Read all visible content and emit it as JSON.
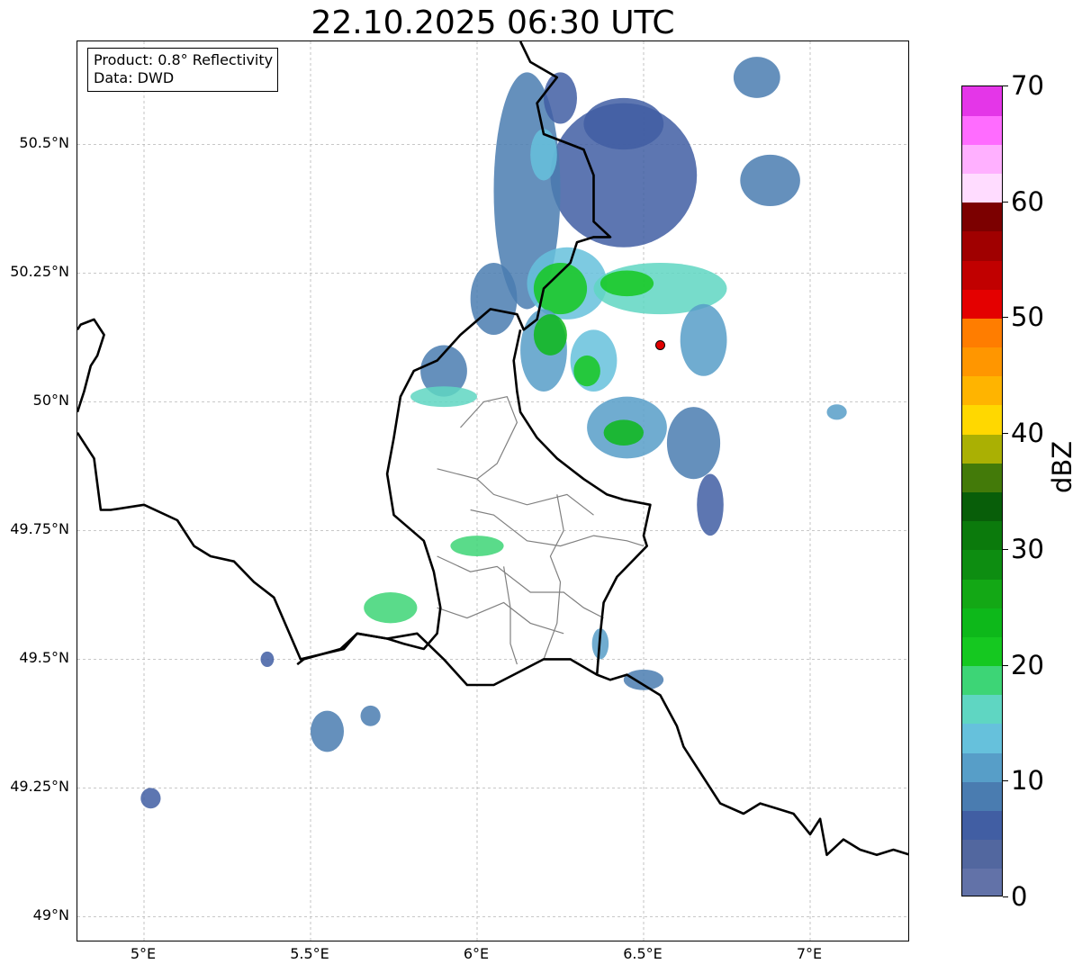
{
  "title": "22.10.2025 06:30 UTC",
  "info": {
    "product": "Product: 0.8° Reflectivity",
    "source": "Data: DWD"
  },
  "map": {
    "lon_range": [
      4.8,
      7.3
    ],
    "lat_range": [
      48.95,
      50.7
    ],
    "gridlines": true,
    "lat_ticks": [
      {
        "value": 50.5,
        "label": "50.5°N"
      },
      {
        "value": 50.25,
        "label": "50.25°N"
      },
      {
        "value": 50.0,
        "label": "50°N"
      },
      {
        "value": 49.75,
        "label": "49.75°N"
      },
      {
        "value": 49.5,
        "label": "49.5°N"
      },
      {
        "value": 49.25,
        "label": "49.25°N"
      },
      {
        "value": 49.0,
        "label": "49°N"
      }
    ],
    "lon_ticks": [
      {
        "value": 5.0,
        "label": "5°E"
      },
      {
        "value": 5.5,
        "label": "5.5°E"
      },
      {
        "value": 6.0,
        "label": "6°E"
      },
      {
        "value": 6.5,
        "label": "6.5°E"
      },
      {
        "value": 7.0,
        "label": "7°E"
      }
    ],
    "radar_site": {
      "lon": 6.55,
      "lat": 50.11,
      "color": "#e00000"
    },
    "borders": {
      "north": [
        [
          6.13,
          50.7
        ],
        [
          6.16,
          50.66
        ],
        [
          6.24,
          50.63
        ],
        [
          6.18,
          50.58
        ],
        [
          6.2,
          50.52
        ],
        [
          6.32,
          50.49
        ],
        [
          6.35,
          50.44
        ],
        [
          6.35,
          50.35
        ],
        [
          6.4,
          50.32
        ],
        [
          6.35,
          50.32
        ],
        [
          6.3,
          50.31
        ],
        [
          6.28,
          50.27
        ],
        [
          6.2,
          50.22
        ],
        [
          6.18,
          50.16
        ],
        [
          6.14,
          50.14
        ],
        [
          6.12,
          50.17
        ],
        [
          6.04,
          50.18
        ],
        [
          5.95,
          50.13
        ],
        [
          5.88,
          50.08
        ],
        [
          5.81,
          50.06
        ],
        [
          5.77,
          50.01
        ],
        [
          5.75,
          49.93
        ],
        [
          5.73,
          49.86
        ],
        [
          5.75,
          49.78
        ],
        [
          5.84,
          49.73
        ],
        [
          5.87,
          49.67
        ],
        [
          5.89,
          49.6
        ],
        [
          5.88,
          49.55
        ],
        [
          5.84,
          49.52
        ],
        [
          5.78,
          49.53
        ],
        [
          5.73,
          49.54
        ],
        [
          5.64,
          49.55
        ],
        [
          5.59,
          49.52
        ],
        [
          5.48,
          49.5
        ],
        [
          5.46,
          49.49
        ]
      ],
      "east": [
        [
          6.13,
          50.14
        ],
        [
          6.11,
          50.08
        ],
        [
          6.12,
          50.02
        ],
        [
          6.13,
          49.98
        ],
        [
          6.18,
          49.93
        ],
        [
          6.24,
          49.89
        ],
        [
          6.32,
          49.85
        ],
        [
          6.39,
          49.82
        ],
        [
          6.44,
          49.81
        ],
        [
          6.52,
          49.8
        ],
        [
          6.5,
          49.74
        ],
        [
          6.51,
          49.72
        ],
        [
          6.42,
          49.66
        ],
        [
          6.38,
          49.61
        ],
        [
          6.37,
          49.55
        ],
        [
          6.36,
          49.47
        ],
        [
          6.4,
          49.46
        ],
        [
          6.45,
          49.47
        ],
        [
          6.55,
          49.43
        ],
        [
          6.6,
          49.37
        ],
        [
          6.62,
          49.33
        ],
        [
          6.67,
          49.28
        ],
        [
          6.73,
          49.22
        ],
        [
          6.8,
          49.2
        ],
        [
          6.85,
          49.22
        ],
        [
          6.9,
          49.21
        ],
        [
          6.95,
          49.2
        ],
        [
          7.0,
          49.16
        ],
        [
          7.03,
          49.19
        ],
        [
          7.05,
          49.12
        ],
        [
          7.1,
          49.15
        ],
        [
          7.15,
          49.13
        ],
        [
          7.2,
          49.12
        ],
        [
          7.25,
          49.13
        ],
        [
          7.3,
          49.12
        ]
      ],
      "south": [
        [
          6.36,
          49.47
        ],
        [
          6.28,
          49.5
        ],
        [
          6.2,
          49.5
        ],
        [
          6.11,
          49.47
        ],
        [
          6.05,
          49.45
        ],
        [
          5.97,
          49.45
        ],
        [
          5.9,
          49.5
        ],
        [
          5.82,
          49.55
        ],
        [
          5.73,
          49.54
        ],
        [
          5.64,
          49.55
        ],
        [
          5.6,
          49.52
        ],
        [
          5.47,
          49.5
        ],
        [
          5.39,
          49.62
        ],
        [
          5.33,
          49.65
        ],
        [
          5.27,
          49.69
        ],
        [
          5.2,
          49.7
        ],
        [
          5.15,
          49.72
        ],
        [
          5.1,
          49.77
        ],
        [
          5.0,
          49.8
        ],
        [
          4.9,
          49.79
        ],
        [
          4.87,
          49.79
        ],
        [
          4.86,
          49.84
        ],
        [
          4.85,
          49.89
        ],
        [
          4.82,
          49.92
        ],
        [
          4.8,
          49.94
        ]
      ],
      "west": [
        [
          4.8,
          49.98
        ],
        [
          4.82,
          50.02
        ],
        [
          4.84,
          50.07
        ],
        [
          4.86,
          50.09
        ],
        [
          4.88,
          50.13
        ],
        [
          4.85,
          50.16
        ],
        [
          4.81,
          50.15
        ],
        [
          4.8,
          50.14
        ]
      ]
    },
    "cantons": [
      [
        [
          5.95,
          49.95
        ],
        [
          6.02,
          50.0
        ],
        [
          6.09,
          50.01
        ],
        [
          6.12,
          49.96
        ],
        [
          6.06,
          49.88
        ],
        [
          6.0,
          49.85
        ]
      ],
      [
        [
          5.88,
          49.87
        ],
        [
          6.0,
          49.85
        ],
        [
          6.05,
          49.82
        ],
        [
          6.15,
          49.8
        ],
        [
          6.27,
          49.82
        ],
        [
          6.35,
          49.78
        ]
      ],
      [
        [
          5.98,
          49.79
        ],
        [
          6.05,
          49.78
        ],
        [
          6.15,
          49.73
        ],
        [
          6.25,
          49.72
        ],
        [
          6.35,
          49.74
        ],
        [
          6.45,
          49.73
        ],
        [
          6.5,
          49.72
        ]
      ],
      [
        [
          5.88,
          49.7
        ],
        [
          5.98,
          49.67
        ],
        [
          6.06,
          49.68
        ],
        [
          6.16,
          49.63
        ],
        [
          6.26,
          49.63
        ],
        [
          6.32,
          49.6
        ],
        [
          6.38,
          49.58
        ]
      ],
      [
        [
          5.88,
          49.6
        ],
        [
          5.97,
          49.58
        ],
        [
          6.08,
          49.61
        ],
        [
          6.16,
          49.57
        ],
        [
          6.26,
          49.55
        ]
      ],
      [
        [
          6.08,
          49.68
        ],
        [
          6.1,
          49.6
        ],
        [
          6.1,
          49.53
        ],
        [
          6.12,
          49.49
        ]
      ],
      [
        [
          6.24,
          49.82
        ],
        [
          6.26,
          49.75
        ],
        [
          6.22,
          49.7
        ],
        [
          6.25,
          49.65
        ],
        [
          6.24,
          49.57
        ],
        [
          6.2,
          49.5
        ]
      ]
    ]
  },
  "reflectivity": {
    "cells": [
      {
        "lon": 6.44,
        "lat": 50.44,
        "rx": 0.22,
        "ry": 0.14,
        "dbz": 6
      },
      {
        "lon": 6.15,
        "lat": 50.41,
        "rx": 0.1,
        "ry": 0.23,
        "dbz": 9
      },
      {
        "lon": 6.2,
        "lat": 50.48,
        "rx": 0.04,
        "ry": 0.05,
        "dbz": 14
      },
      {
        "lon": 6.44,
        "lat": 50.54,
        "rx": 0.12,
        "ry": 0.05,
        "dbz": 7
      },
      {
        "lon": 6.25,
        "lat": 50.59,
        "rx": 0.05,
        "ry": 0.05,
        "dbz": 6
      },
      {
        "lon": 6.84,
        "lat": 50.63,
        "rx": 0.07,
        "ry": 0.04,
        "dbz": 8
      },
      {
        "lon": 6.88,
        "lat": 50.43,
        "rx": 0.09,
        "ry": 0.05,
        "dbz": 9
      },
      {
        "lon": 6.05,
        "lat": 50.2,
        "rx": 0.07,
        "ry": 0.07,
        "dbz": 9
      },
      {
        "lon": 6.27,
        "lat": 50.23,
        "rx": 0.12,
        "ry": 0.07,
        "dbz": 14
      },
      {
        "lon": 6.25,
        "lat": 50.22,
        "rx": 0.08,
        "ry": 0.05,
        "dbz": 22
      },
      {
        "lon": 6.55,
        "lat": 50.22,
        "rx": 0.2,
        "ry": 0.05,
        "dbz": 15
      },
      {
        "lon": 6.45,
        "lat": 50.23,
        "rx": 0.08,
        "ry": 0.025,
        "dbz": 21
      },
      {
        "lon": 6.2,
        "lat": 50.1,
        "rx": 0.07,
        "ry": 0.08,
        "dbz": 12
      },
      {
        "lon": 6.22,
        "lat": 50.13,
        "rx": 0.05,
        "ry": 0.04,
        "dbz": 24
      },
      {
        "lon": 6.35,
        "lat": 50.08,
        "rx": 0.07,
        "ry": 0.06,
        "dbz": 14
      },
      {
        "lon": 6.33,
        "lat": 50.06,
        "rx": 0.04,
        "ry": 0.03,
        "dbz": 22
      },
      {
        "lon": 6.45,
        "lat": 49.95,
        "rx": 0.12,
        "ry": 0.06,
        "dbz": 12
      },
      {
        "lon": 6.44,
        "lat": 49.94,
        "rx": 0.06,
        "ry": 0.025,
        "dbz": 23
      },
      {
        "lon": 6.68,
        "lat": 50.12,
        "rx": 0.07,
        "ry": 0.07,
        "dbz": 10
      },
      {
        "lon": 6.65,
        "lat": 49.92,
        "rx": 0.08,
        "ry": 0.07,
        "dbz": 8
      },
      {
        "lon": 6.7,
        "lat": 49.8,
        "rx": 0.04,
        "ry": 0.06,
        "dbz": 7
      },
      {
        "lon": 5.9,
        "lat": 50.06,
        "rx": 0.07,
        "ry": 0.05,
        "dbz": 9
      },
      {
        "lon": 5.9,
        "lat": 50.01,
        "rx": 0.1,
        "ry": 0.02,
        "dbz": 16
      },
      {
        "lon": 6.0,
        "lat": 49.72,
        "rx": 0.08,
        "ry": 0.02,
        "dbz": 18
      },
      {
        "lon": 5.74,
        "lat": 49.6,
        "rx": 0.08,
        "ry": 0.03,
        "dbz": 18
      },
      {
        "lon": 5.55,
        "lat": 49.36,
        "rx": 0.05,
        "ry": 0.04,
        "dbz": 9
      },
      {
        "lon": 5.68,
        "lat": 49.39,
        "rx": 0.03,
        "ry": 0.02,
        "dbz": 8
      },
      {
        "lon": 6.5,
        "lat": 49.46,
        "rx": 0.06,
        "ry": 0.02,
        "dbz": 9
      },
      {
        "lon": 6.37,
        "lat": 49.53,
        "rx": 0.025,
        "ry": 0.03,
        "dbz": 12
      },
      {
        "lon": 7.08,
        "lat": 49.98,
        "rx": 0.03,
        "ry": 0.015,
        "dbz": 12
      },
      {
        "lon": 5.02,
        "lat": 49.23,
        "rx": 0.03,
        "ry": 0.02,
        "dbz": 7
      },
      {
        "lon": 5.37,
        "lat": 49.5,
        "rx": 0.02,
        "ry": 0.015,
        "dbz": 7
      }
    ]
  },
  "colorbar": {
    "label": "dBZ",
    "min": 0,
    "max": 70,
    "step": 2.5,
    "ticks": [
      "0",
      "10",
      "20",
      "30",
      "40",
      "50",
      "60",
      "70"
    ],
    "tick_values": [
      0,
      10,
      20,
      30,
      40,
      50,
      60,
      70
    ],
    "colors": [
      "#6272a8",
      "#52679f",
      "#415ea3",
      "#4a7cb0",
      "#579ec8",
      "#66c1dc",
      "#5fd6c2",
      "#3dd576",
      "#15c820",
      "#0db81a",
      "#13a815",
      "#0d8d11",
      "#0b7a0c",
      "#085e09",
      "#437a09",
      "#aab003",
      "#ffd800",
      "#ffb400",
      "#ff9600",
      "#ff7d00",
      "#e40000",
      "#c10000",
      "#a00000",
      "#7c0000",
      "#ffdcff",
      "#ffb0ff",
      "#ff6cff",
      "#e436e8"
    ]
  }
}
